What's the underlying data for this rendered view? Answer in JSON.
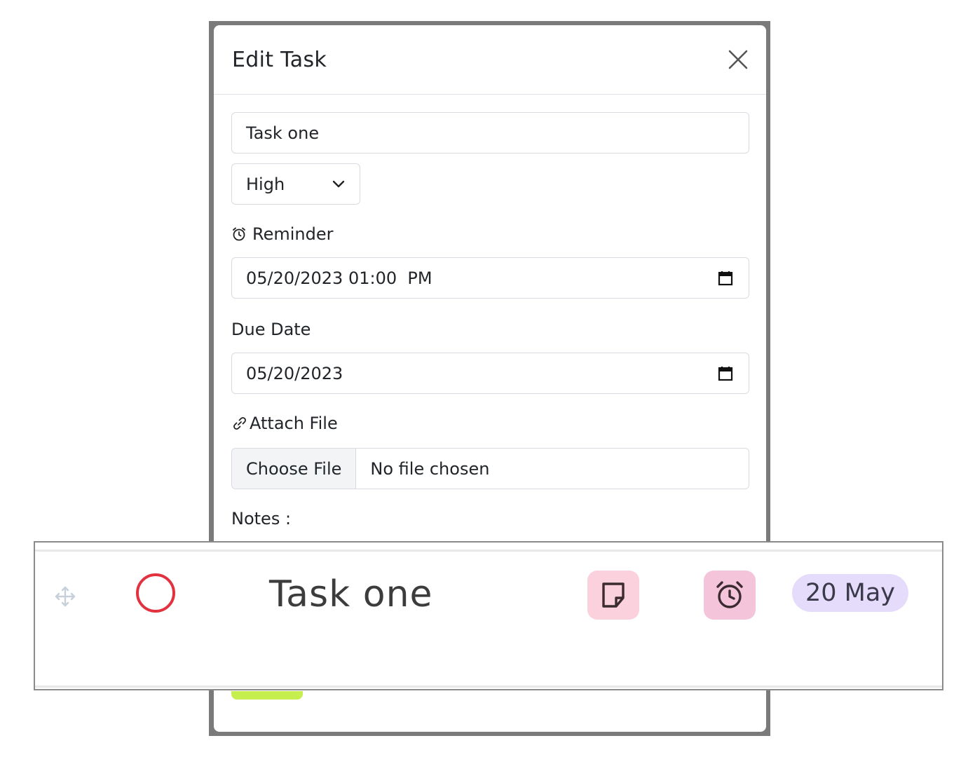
{
  "modal": {
    "title": "Edit Task",
    "task_name_value": "Task one",
    "priority_selected": "High",
    "reminder_label": "Reminder",
    "reminder_value": "05/20/2023 01:00  PM",
    "due_date_label": "Due Date",
    "due_date_value": "05/20/2023",
    "attach_label": "Attach File",
    "choose_file_label": "Choose File",
    "file_status": "No file chosen",
    "notes_label": "Notes :"
  },
  "task_row": {
    "title": "Task one",
    "date_badge": "20 May",
    "priority_color": "#e2323f",
    "note_icon": "sticky-note-icon",
    "alarm_icon": "alarm-clock-icon",
    "drag_icon": "move-arrows-icon"
  },
  "colors": {
    "note_tile": "#fbd1dd",
    "alarm_tile": "#f4c4da",
    "date_pill": "#e5dcfb",
    "accent_green": "#c6ee4f"
  }
}
